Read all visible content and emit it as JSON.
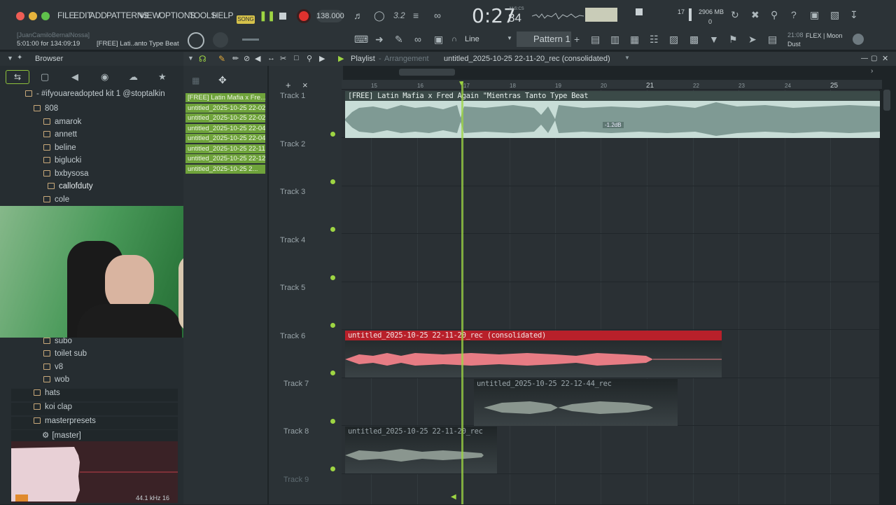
{
  "app": {
    "menu": [
      "FILE",
      "EDIT",
      "ADD",
      "PATTERNS",
      "VIEW",
      "OPTIONS",
      "TOOLS",
      "HELP"
    ],
    "mode": "SONG",
    "tempo": "138.000",
    "time": "0:27",
    "time_sub": "84",
    "time_label": "M:S:CS",
    "cpu_num": "17",
    "mem": "2906 MB",
    "mem_sub": "0",
    "hint_user": "[JuanCamiloBernalNossa]",
    "hint_time": "5:01:00 for 134:09:19",
    "hint_name": "[FREE] Lati..anto Type Beat",
    "snap": "Line",
    "pattern": "Pattern 1",
    "flex_time": "21:08",
    "flex_name": "FLEX | Moon Dust"
  },
  "browser": {
    "title": "Browser",
    "root": "#ifyouareadopted kit 1 @stoptalkin",
    "items": [
      {
        "label": "808",
        "level": 1
      },
      {
        "label": "amarok",
        "level": 2
      },
      {
        "label": "annett",
        "level": 2
      },
      {
        "label": "beline",
        "level": 2
      },
      {
        "label": "biglucki",
        "level": 2
      },
      {
        "label": "bxbysosa",
        "level": 2
      },
      {
        "label": "callofduty",
        "level": 3
      },
      {
        "label": "cole",
        "level": 2
      }
    ],
    "items2": [
      {
        "label": "subo",
        "level": 2
      },
      {
        "label": "toilet sub",
        "level": 2
      },
      {
        "label": "v8",
        "level": 2
      },
      {
        "label": "wob",
        "level": 2
      },
      {
        "label": "hats",
        "level": 1
      },
      {
        "label": "koi clap",
        "level": 1
      },
      {
        "label": "masterpresets",
        "level": 1
      },
      {
        "label": "[master]",
        "level": 2
      }
    ],
    "samplerate": "44.1 kHz 16"
  },
  "picker": [
    "[FREE] Latin Mafia x Fre...",
    "untitled_2025-10-25 22-02...",
    "untitled_2025-10-25 22-02...",
    "untitled_2025-10-25 22-04...",
    "untitled_2025-10-25 22-04...",
    "untitled_2025-10-25 22-11...",
    "untitled_2025-10-25 22-12...",
    "untitled_2025-10-25 2..."
  ],
  "playlist": {
    "title": "Playlist",
    "subtitle": "Arrangement",
    "pattern_name": "untitled_2025-10-25 22-11-20_rec (consolidated)",
    "ruler": [
      "15",
      "16",
      "17",
      "18",
      "19",
      "20",
      "21",
      "22",
      "23",
      "24",
      "25"
    ],
    "tracks": [
      "Track 1",
      "Track 2",
      "Track 3",
      "Track 4",
      "Track 5",
      "Track 6",
      "Track 7",
      "Track 8",
      "Track 9"
    ],
    "clip1": "[FREE] Latin Mafia x Fred Again \"Mientras Tanto Type Beat",
    "clip1_gain": "-1.2dB",
    "clip6": "untitled_2025-10-25 22-11-20_rec (consolidated)",
    "clip7": "untitled_2025-10-25 22-12-44_rec",
    "clip8": "untitled_2025-10-25 22-11-20_rec"
  },
  "colors": {
    "accent": "#9ed543",
    "record": "#e0322e",
    "clip_red": "#b8202a",
    "clip_teal": "#cfe3de"
  }
}
